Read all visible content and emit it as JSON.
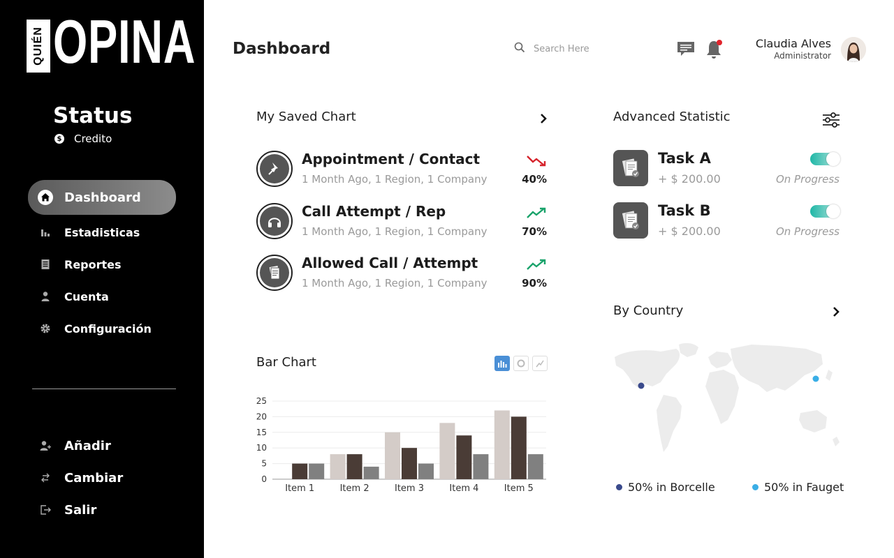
{
  "brand": {
    "logo_small": "QUIÉN",
    "logo_big": "OPINA"
  },
  "status": {
    "title": "Status",
    "subtitle": "Credito",
    "coin_icon": "dollar-coin-icon"
  },
  "nav": {
    "items": [
      {
        "label": "Dashboard",
        "icon": "home-icon",
        "active": true
      },
      {
        "label": "Estadisticas",
        "icon": "bar-chart-icon"
      },
      {
        "label": "Reportes",
        "icon": "document-icon"
      },
      {
        "label": "Cuenta",
        "icon": "user-icon"
      },
      {
        "label": "Configuración",
        "icon": "gear-icon"
      }
    ],
    "bottom": [
      {
        "label": "Añadir",
        "icon": "add-user-icon"
      },
      {
        "label": "Cambiar",
        "icon": "swap-icon"
      },
      {
        "label": "Salir",
        "icon": "logout-icon"
      }
    ]
  },
  "header": {
    "title": "Dashboard",
    "search_placeholder": "Search Here",
    "user_name": "Claudia Alves",
    "user_role": "Administrator",
    "notification_badge_color": "#e0242c"
  },
  "saved_chart": {
    "title": "My Saved Chart",
    "items": [
      {
        "title": "Appointment / Contact",
        "sub": "1 Month Ago, 1 Region, 1 Company",
        "pct": "40%",
        "trend": "down",
        "icon": "pin-icon"
      },
      {
        "title": "Call Attempt / Rep",
        "sub": "1 Month Ago, 1 Region, 1 Company",
        "pct": "70%",
        "trend": "up",
        "icon": "headphones-icon"
      },
      {
        "title": "Allowed Call / Attempt",
        "sub": "1 Month Ago, 1 Region, 1 Company",
        "pct": "90%",
        "trend": "up",
        "icon": "papers-icon"
      }
    ]
  },
  "bar_chart_section": {
    "title": "Bar Chart"
  },
  "advanced": {
    "title": "Advanced Statistic",
    "tasks": [
      {
        "title": "Task A",
        "amount": "+ $ 200.00",
        "status": "On Progress",
        "enabled": true
      },
      {
        "title": "Task B",
        "amount": "+ $ 200.00",
        "status": "On Progress",
        "enabled": true
      }
    ]
  },
  "by_country": {
    "title": "By Country",
    "legend": [
      {
        "label": "50% in Borcelle",
        "color": "#3a4a8c"
      },
      {
        "label": "50% in Fauget",
        "color": "#3aaee6"
      }
    ]
  },
  "colors": {
    "trend_up": "#1aa36b",
    "trend_down": "#d6242c",
    "bar_light": "#d4ccc8",
    "bar_dark": "#4a3c36",
    "bar_gray": "#808080"
  },
  "chart_data": {
    "type": "bar",
    "categories": [
      "Item 1",
      "Item 2",
      "Item 3",
      "Item 4",
      "Item 5"
    ],
    "series": [
      {
        "values": [
          0,
          8,
          15,
          18,
          22
        ]
      },
      {
        "values": [
          5,
          8,
          10,
          14,
          20
        ]
      },
      {
        "values": [
          5,
          4,
          5,
          8,
          8
        ]
      }
    ],
    "yticks": [
      0,
      5,
      10,
      15,
      20,
      25
    ],
    "ylim": [
      0,
      25
    ],
    "grid": true
  }
}
